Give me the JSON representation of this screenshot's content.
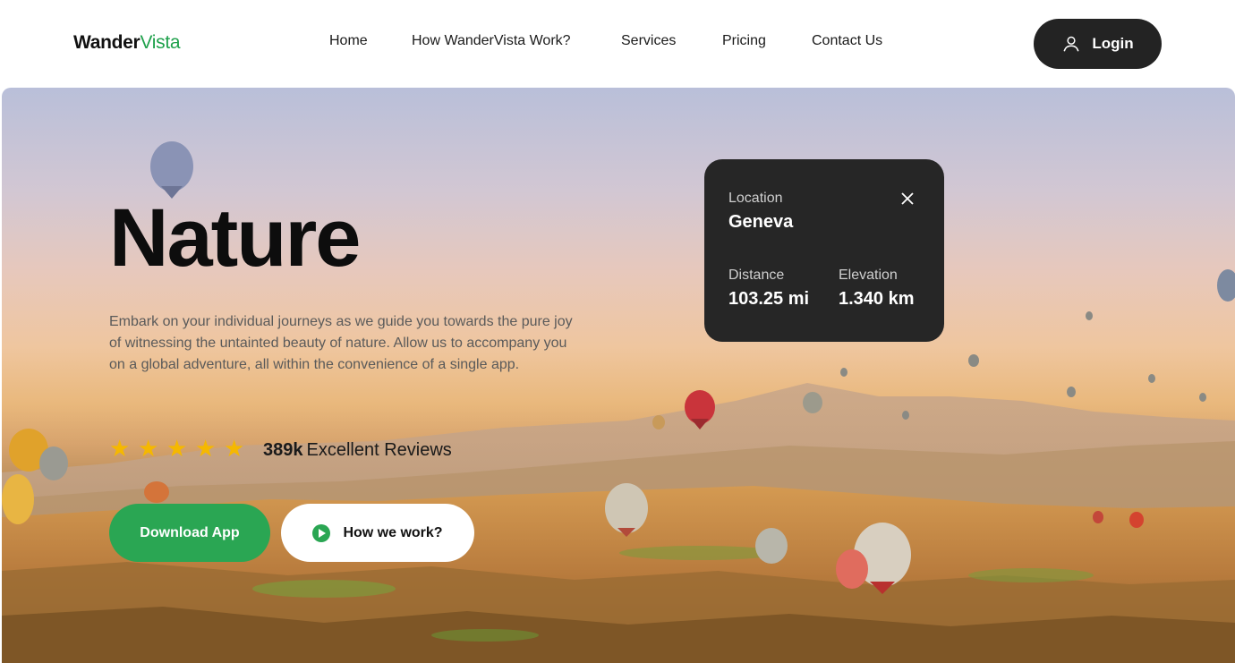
{
  "brand": {
    "name_part1": "Wander",
    "name_part2": "Vista",
    "accent": "#1fa14c"
  },
  "nav": {
    "items": [
      {
        "label": "Home"
      },
      {
        "label": "How WanderVista Work?"
      },
      {
        "label": "Services"
      },
      {
        "label": "Pricing"
      },
      {
        "label": "Contact Us"
      }
    ],
    "login_label": "Login",
    "login_icon": "user-icon"
  },
  "hero": {
    "title": "Nature",
    "description": "Embark on your individual journeys as we guide you towards the pure joy of witnessing the untainted beauty of nature. Allow us to accompany you on a global adventure, all within the convenience of a single app.",
    "rating_stars": 5,
    "reviews_count": "389k",
    "reviews_text": "Excellent Reviews",
    "download_label": "Download App",
    "how_label": "How we work?"
  },
  "location_card": {
    "location_label": "Location",
    "location_value": "Geneva",
    "distance_label": "Distance",
    "distance_value": "103.25 mi",
    "elevation_label": "Elevation",
    "elevation_value": "1.340 km"
  },
  "colors": {
    "green": "#2aa653",
    "dark": "#232323",
    "star": "#f5b800"
  }
}
